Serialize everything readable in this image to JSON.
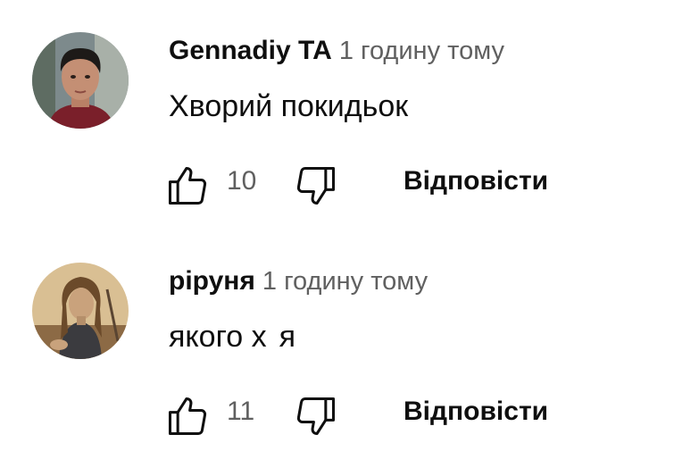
{
  "comments": [
    {
      "author": "Gennadiy TA",
      "time": "1 годину тому",
      "text": "Хворий покидьок",
      "likes": "10",
      "reply_label": "Відповісти",
      "avatar_icon": "user-photo-avatar"
    },
    {
      "author": "ріруня",
      "time": "1 годину тому",
      "text_before": "якого х",
      "text_after": "я",
      "likes": "11",
      "reply_label": "Відповісти",
      "avatar_icon": "user-drawing-avatar"
    }
  ],
  "icons": {
    "like": "thumbs-up-icon",
    "dislike": "thumbs-down-icon"
  }
}
